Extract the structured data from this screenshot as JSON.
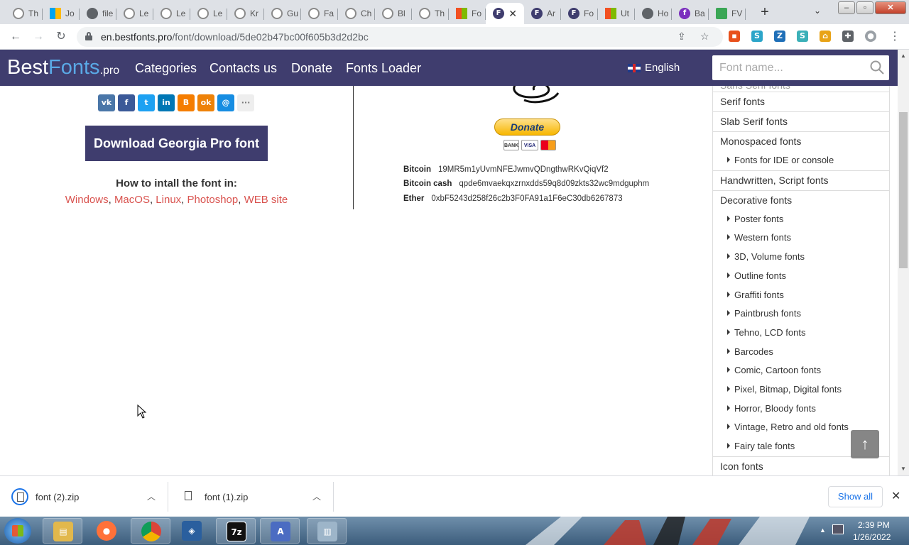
{
  "browser": {
    "tabs": [
      {
        "title": "Th",
        "icon": "gray",
        "active": false
      },
      {
        "title": "Jo",
        "icon": "msb",
        "active": false
      },
      {
        "title": "file",
        "icon": "globe",
        "active": false
      },
      {
        "title": "Le",
        "icon": "gray",
        "active": false
      },
      {
        "title": "Le",
        "icon": "gray",
        "active": false
      },
      {
        "title": "Le",
        "icon": "gray",
        "active": false
      },
      {
        "title": "Kr",
        "icon": "gray",
        "active": false
      },
      {
        "title": "Gu",
        "icon": "gray",
        "active": false
      },
      {
        "title": "Fa",
        "icon": "gray",
        "active": false
      },
      {
        "title": "Ch",
        "icon": "gray",
        "active": false
      },
      {
        "title": "Bl",
        "icon": "gray",
        "active": false
      },
      {
        "title": "Th",
        "icon": "gray",
        "active": false
      },
      {
        "title": "Fo",
        "icon": "ms",
        "active": false
      },
      {
        "title": "",
        "icon": "f",
        "active": true
      },
      {
        "title": "Ar",
        "icon": "f",
        "active": false
      },
      {
        "title": "Fo",
        "icon": "f",
        "active": false
      },
      {
        "title": "Ut",
        "icon": "ms",
        "active": false
      },
      {
        "title": "Ho",
        "icon": "globe",
        "active": false
      },
      {
        "title": "Ba",
        "icon": "ps",
        "active": false
      },
      {
        "title": "FV",
        "icon": "fv",
        "active": false
      }
    ],
    "url_host": "en.bestfonts.pro",
    "url_path": "/font/download/5de02b47bc00f605b3d2d2bc"
  },
  "site": {
    "logo": {
      "best": "Best",
      "fonts": "Fonts",
      "pro": ".pro"
    },
    "nav": [
      "Categories",
      "Contacts us",
      "Donate",
      "Fonts Loader"
    ],
    "language": "English",
    "search_placeholder": "Font name..."
  },
  "download": {
    "button_label": "Download Georgia Pro font",
    "howto_title": "How to intall the font in:",
    "howto_links": [
      "Windows",
      "MacOS",
      "Linux",
      "Photoshop",
      "WEB site"
    ],
    "share_icons": [
      {
        "name": "vk",
        "label": "vk",
        "color": "#4a76a8"
      },
      {
        "name": "facebook",
        "label": "f",
        "color": "#3b5998"
      },
      {
        "name": "twitter",
        "label": "t",
        "color": "#1da1f2"
      },
      {
        "name": "linkedin",
        "label": "in",
        "color": "#0077b5"
      },
      {
        "name": "blogger",
        "label": "B",
        "color": "#f57d00"
      },
      {
        "name": "odnoklassniki",
        "label": "ok",
        "color": "#ee8208"
      },
      {
        "name": "moimir",
        "label": "@",
        "color": "#168de2"
      },
      {
        "name": "more",
        "label": "···",
        "color": "#eeeeee"
      }
    ]
  },
  "donate": {
    "button_label": "Donate",
    "cards": [
      "BANK",
      "VISA",
      "MC"
    ],
    "crypto": [
      {
        "label": "Bitcoin",
        "address": "19MR5m1yUvmNFEJwmvQDngthwRKvQiqVf2"
      },
      {
        "label": "Bitcoin cash",
        "address": "qpde6mvaekqxzrnxdds59q8d09zkts32wc9mdguphm"
      },
      {
        "label": "Ether",
        "address": "0xbF5243d258f26c2b3F0FA91a1F6eC30db6267873"
      }
    ]
  },
  "sidebar": {
    "partial_top": "Sans Serif fonts",
    "items": [
      {
        "label": "Serif fonts",
        "level": "main"
      },
      {
        "label": "Slab Serif fonts",
        "level": "main"
      },
      {
        "label": "Monospaced fonts",
        "level": "main"
      },
      {
        "label": "Fonts for IDE or console",
        "level": "sub"
      },
      {
        "label": "Handwritten, Script fonts",
        "level": "main"
      },
      {
        "label": "Decorative fonts",
        "level": "main"
      },
      {
        "label": "Poster fonts",
        "level": "sub"
      },
      {
        "label": "Western fonts",
        "level": "sub"
      },
      {
        "label": "3D, Volume fonts",
        "level": "sub"
      },
      {
        "label": "Outline fonts",
        "level": "sub"
      },
      {
        "label": "Graffiti fonts",
        "level": "sub"
      },
      {
        "label": "Paintbrush fonts",
        "level": "sub"
      },
      {
        "label": "Tehno, LCD fonts",
        "level": "sub"
      },
      {
        "label": "Barcodes",
        "level": "sub"
      },
      {
        "label": "Comic, Cartoon fonts",
        "level": "sub"
      },
      {
        "label": "Pixel, Bitmap, Digital fonts",
        "level": "sub"
      },
      {
        "label": "Horror, Bloody fonts",
        "level": "sub"
      },
      {
        "label": "Vintage, Retro and old fonts",
        "level": "sub"
      },
      {
        "label": "Fairy tale fonts",
        "level": "sub"
      },
      {
        "label": "Icon fonts",
        "level": "main"
      }
    ]
  },
  "downloads_shelf": {
    "items": [
      "font (2).zip",
      "font (1).zip"
    ],
    "show_all": "Show all"
  },
  "taskbar": {
    "apps": [
      "explorer",
      "firefox",
      "chrome",
      "virtualbox",
      "7z",
      "app",
      "network"
    ],
    "time": "2:39 PM",
    "date": "1/26/2022"
  },
  "colors": {
    "header_bg": "#3f3d6e",
    "link": "#d9534f",
    "logo_accent": "#5aa9e6"
  }
}
